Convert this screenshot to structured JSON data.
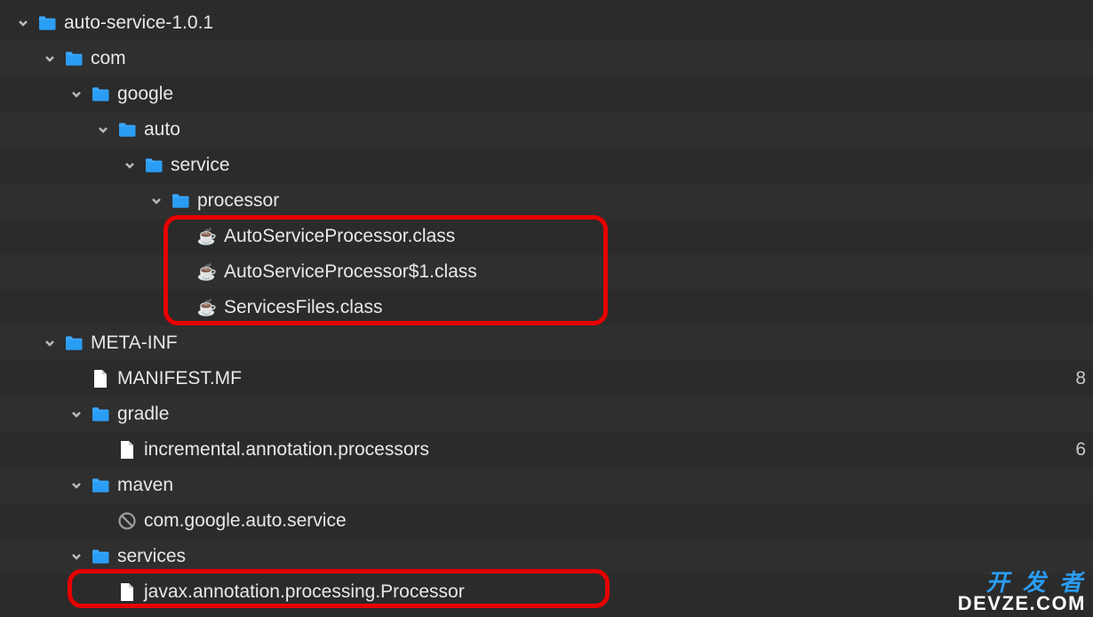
{
  "tree": [
    {
      "indent": 0,
      "chevron": true,
      "icon": "folder",
      "label": "auto-service-1.0.1"
    },
    {
      "indent": 1,
      "chevron": true,
      "icon": "folder",
      "label": "com"
    },
    {
      "indent": 2,
      "chevron": true,
      "icon": "folder",
      "label": "google"
    },
    {
      "indent": 3,
      "chevron": true,
      "icon": "folder",
      "label": "auto"
    },
    {
      "indent": 4,
      "chevron": true,
      "icon": "folder",
      "label": "service"
    },
    {
      "indent": 5,
      "chevron": true,
      "icon": "folder",
      "label": "processor"
    },
    {
      "indent": 6,
      "chevron": false,
      "icon": "class",
      "label": "AutoServiceProcessor.class"
    },
    {
      "indent": 6,
      "chevron": false,
      "icon": "class",
      "label": "AutoServiceProcessor$1.class"
    },
    {
      "indent": 6,
      "chevron": false,
      "icon": "class",
      "label": "ServicesFiles.class"
    },
    {
      "indent": 1,
      "chevron": true,
      "icon": "folder",
      "label": "META-INF"
    },
    {
      "indent": 2,
      "chevron": false,
      "icon": "file",
      "label": "MANIFEST.MF",
      "rlabel": "8"
    },
    {
      "indent": 2,
      "chevron": true,
      "icon": "folder",
      "label": "gradle"
    },
    {
      "indent": 3,
      "chevron": false,
      "icon": "file",
      "label": "incremental.annotation.processors",
      "rlabel": "6"
    },
    {
      "indent": 2,
      "chevron": true,
      "icon": "folder",
      "label": "maven"
    },
    {
      "indent": 3,
      "chevron": false,
      "icon": "blocked",
      "label": "com.google.auto.service"
    },
    {
      "indent": 2,
      "chevron": true,
      "icon": "folder",
      "label": "services"
    },
    {
      "indent": 3,
      "chevron": false,
      "icon": "file",
      "label": "javax.annotation.processing.Processor"
    }
  ],
  "watermark": {
    "top": "开 发 者",
    "bottom": "DEVZE.COM"
  }
}
